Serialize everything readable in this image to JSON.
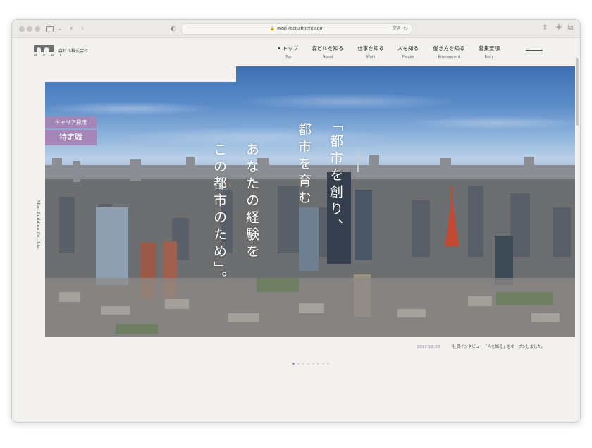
{
  "browser": {
    "url": "mori-recruitment.com",
    "icons": [
      "sidebar-icon",
      "chevron-down-icon",
      "back-icon",
      "forward-icon",
      "shield-icon",
      "lock-icon",
      "translate-icon",
      "reload-icon",
      "share-icon",
      "new-tab-icon",
      "tabs-icon"
    ]
  },
  "header": {
    "logo_word": "M O R I",
    "company": "森ビル株式会社",
    "nav": [
      {
        "ja": "トップ",
        "en": "Top"
      },
      {
        "ja": "森ビルを知る",
        "en": "About"
      },
      {
        "ja": "仕事を知る",
        "en": "Work"
      },
      {
        "ja": "人を知る",
        "en": "People"
      },
      {
        "ja": "働き方を知る",
        "en": "Environment"
      },
      {
        "ja": "募集要項",
        "en": "Entry"
      }
    ]
  },
  "hero": {
    "badge_small": "キャリア採用",
    "badge_large": "特定職",
    "catch": [
      "「都市を創り、",
      "都市を育む",
      "あなたの経験を",
      "この都市のため」。"
    ],
    "side_text": "Mori Building Co., Ltd."
  },
  "news": {
    "date": "2022.12.23",
    "text": "社員インタビュー「人を知る」をオープンしました。"
  },
  "slider": {
    "count": 8,
    "active": 0
  }
}
